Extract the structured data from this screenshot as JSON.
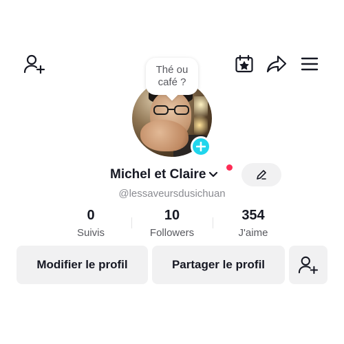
{
  "header": {
    "icons": [
      "add-friend-icon",
      "calendar-star-icon",
      "share-arrow-icon",
      "menu-icon"
    ]
  },
  "profile": {
    "note_line1": "Thé ou",
    "note_line2": "café ?",
    "display_name": "Michel et Claire",
    "username": "@lessaveursdusichuan",
    "avatar_icon": "profile-photo",
    "notification_color": "#fe2c55",
    "add_badge_color": "#20d5ec"
  },
  "stats": {
    "following_count": "0",
    "following_label": "Suivis",
    "followers_count": "10",
    "followers_label": "Followers",
    "likes_count": "354",
    "likes_label": "J'aime"
  },
  "actions": {
    "edit_profile_label": "Modifier le profil",
    "share_profile_label": "Partager le profil"
  }
}
